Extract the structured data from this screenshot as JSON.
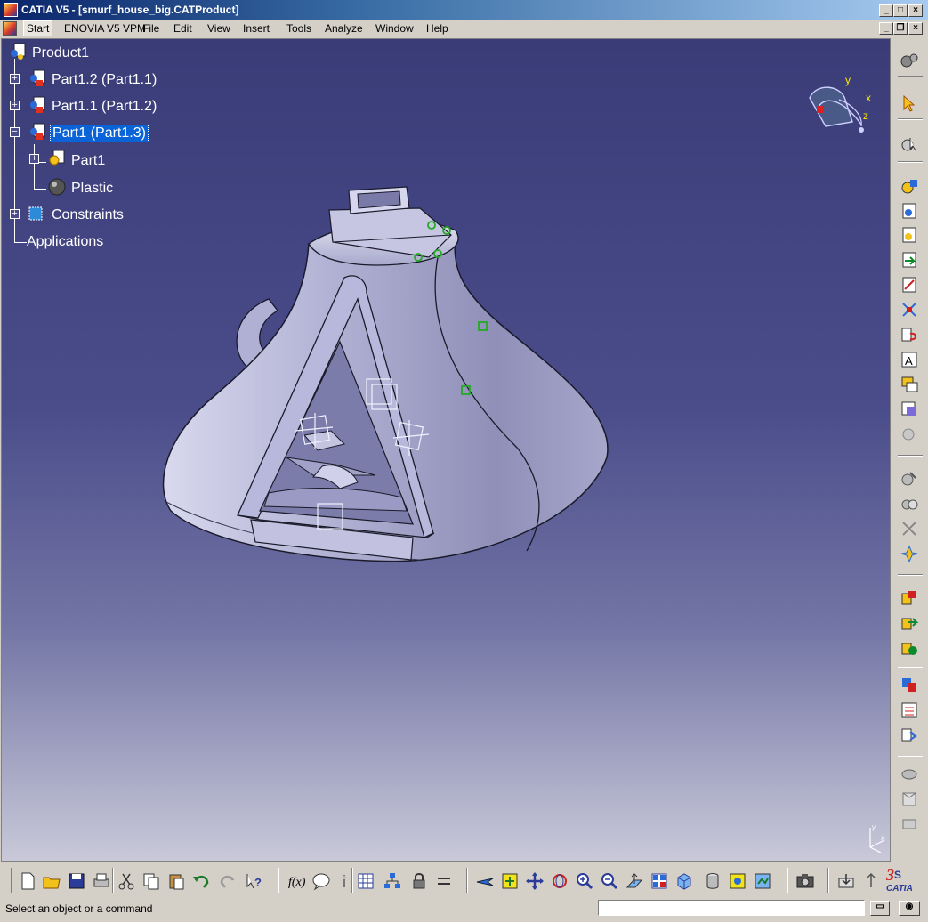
{
  "window": {
    "title": "CATIA V5 - [smurf_house_big.CATProduct]"
  },
  "menu": {
    "items": [
      "Start",
      "ENOVIA V5 VPM",
      "File",
      "Edit",
      "View",
      "Insert",
      "Tools",
      "Analyze",
      "Window",
      "Help"
    ]
  },
  "tree": {
    "root": "Product1",
    "nodes": [
      {
        "label": "Part1.2 (Part1.1)"
      },
      {
        "label": "Part1.1 (Part1.2)"
      },
      {
        "label": "Part1 (Part1.3)"
      },
      {
        "label": "Part1"
      },
      {
        "label": "Plastic"
      },
      {
        "label": "Constraints"
      },
      {
        "label": "Applications"
      }
    ]
  },
  "compass": {
    "x": "x",
    "y": "y",
    "z": "z"
  },
  "status": {
    "message": "Select an object or a command"
  },
  "brand": {
    "logo": "CATIA"
  },
  "colors": {
    "viewport_top": "#3a3c78",
    "viewport_bottom": "#c9c9d9",
    "model": "#b6b6d6",
    "selection": "#0a64d8"
  }
}
